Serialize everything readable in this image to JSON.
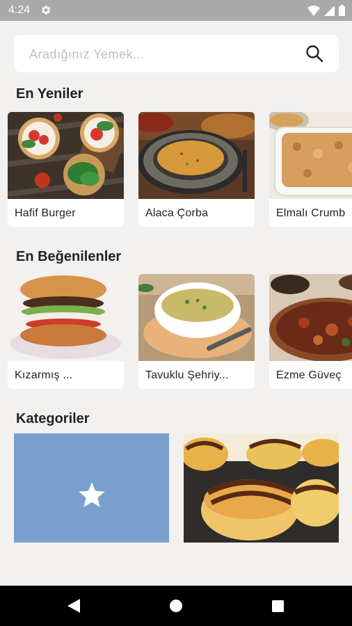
{
  "status": {
    "time": "4:24"
  },
  "search": {
    "placeholder": "Aradığınız Yemek..."
  },
  "sections": {
    "newest": {
      "title": "En Yeniler",
      "items": [
        {
          "label": "Hafif Burger"
        },
        {
          "label": "Alaca Çorba"
        },
        {
          "label": "Elmalı Crumb"
        }
      ]
    },
    "liked": {
      "title": "En Beğenilenler",
      "items": [
        {
          "label": "Kızarmış ..."
        },
        {
          "label": "Tavuklu Şehriy..."
        },
        {
          "label": "Ezme Güveç"
        }
      ]
    },
    "categories": {
      "title": "Kategoriler"
    }
  },
  "colors": {
    "category_tile": "#7a9fcf",
    "statusbar": "#a9a9a9",
    "background": "#f2f1f0"
  }
}
